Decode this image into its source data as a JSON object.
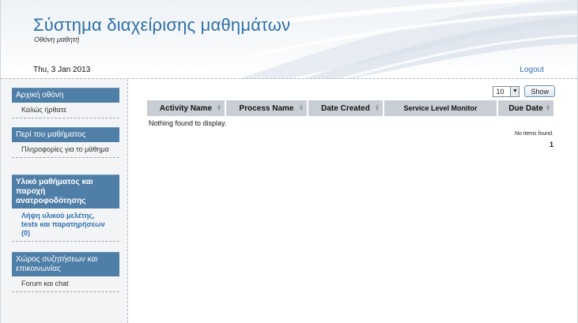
{
  "header": {
    "title": "Σύστημα διαχείρισης μαθημάτων",
    "subtitle": "Οθόνη μαθητή",
    "date": "Thu, 3 Jan 2013",
    "logout_label": "Logout"
  },
  "sidebar": {
    "sections": [
      {
        "heading": "Αρχική οθόνη",
        "items": [
          "Καλώς ήρθατε"
        ]
      },
      {
        "heading": "Περί του μαθήματος",
        "items": [
          "Πληροφορίες για το μάθημα"
        ]
      },
      {
        "heading": "Υλικό μαθήματος και παροχή ανατροφοδότησης",
        "items": [
          "Λήψη υλικού μελέτης, tests και παρατηρήσεων (0)"
        ]
      },
      {
        "heading": "Χώρος συζητήσεων και επικοινωνίας",
        "items": [
          "Forum και chat"
        ]
      }
    ]
  },
  "main": {
    "page_size": "10",
    "show_label": "Show",
    "columns": [
      "Activity Name",
      "Process Name",
      "Date Created",
      "Service Level Monitor",
      "Due Date"
    ],
    "empty_message": "Nothing found to display.",
    "items_found": "No items found.",
    "page_number": "1"
  },
  "colors": {
    "accent": "#4f7ea6",
    "title": "#2d6fa6",
    "link": "#2f6db5"
  }
}
